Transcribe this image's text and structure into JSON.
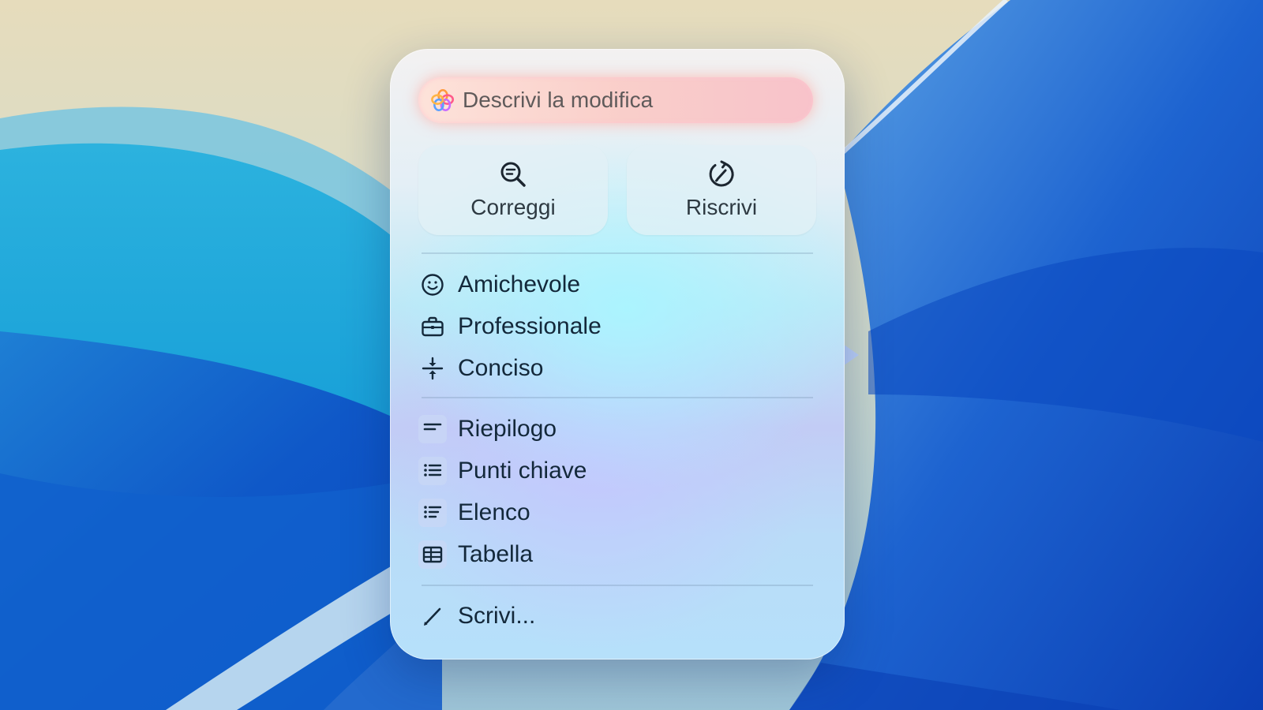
{
  "describe_field": {
    "placeholder": "Descrivi la modifica",
    "icon": "apple-intelligence-icon"
  },
  "primary_actions": [
    {
      "label": "Correggi",
      "icon": "magnifier-proofread-icon"
    },
    {
      "label": "Riscrivi",
      "icon": "rewrite-circle-arrow-icon"
    }
  ],
  "tone_items": [
    {
      "label": "Amichevole",
      "icon": "smiley-face-icon"
    },
    {
      "label": "Professionale",
      "icon": "briefcase-icon"
    },
    {
      "label": "Conciso",
      "icon": "compress-arrows-icon"
    }
  ],
  "format_items": [
    {
      "label": "Riepilogo",
      "icon": "summary-lines-icon"
    },
    {
      "label": "Punti chiave",
      "icon": "bullet-list-icon"
    },
    {
      "label": "Elenco",
      "icon": "list-icon"
    },
    {
      "label": "Tabella",
      "icon": "table-icon"
    }
  ],
  "compose_item": {
    "label": "Scrivi...",
    "icon": "pencil-icon"
  },
  "colors": {
    "text": "#13283a",
    "field_glow": "#f8b8b8"
  }
}
